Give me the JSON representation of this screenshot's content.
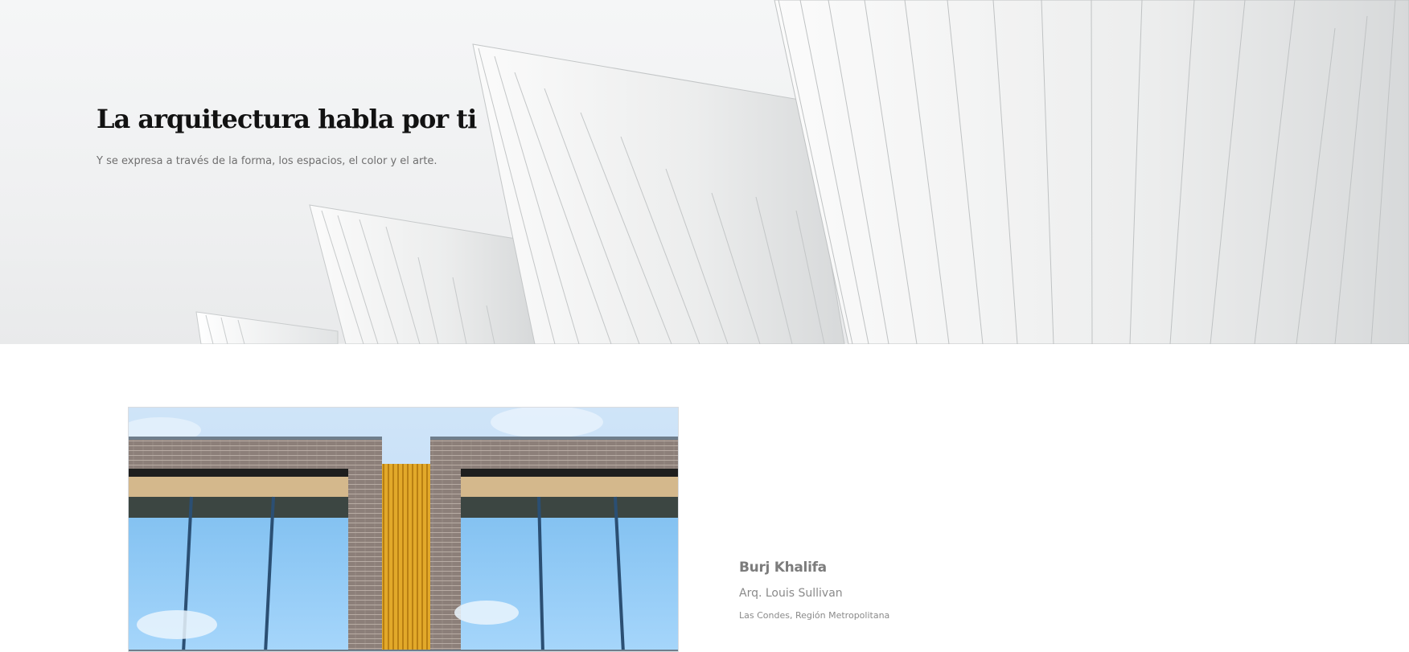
{
  "hero": {
    "title": "La arquitectura habla por ti",
    "subtitle": "Y se expresa a través de la forma, los espacios, el color y el arte.",
    "background_image": "white-architectural-fins-photo"
  },
  "project": {
    "image": "brick-building-facade-photo",
    "name": "Burj Khalifa",
    "architect": "Arq. Louis Sullivan",
    "location": "Las Condes, Región Metropolitana"
  },
  "colors": {
    "title": "#121212",
    "muted_text": "#7c7c7c",
    "hero_bg": "#f2f3f4",
    "sky": "#9fd0f4",
    "brick": "#8a7d78",
    "accent_yellow": "#e0a425"
  }
}
